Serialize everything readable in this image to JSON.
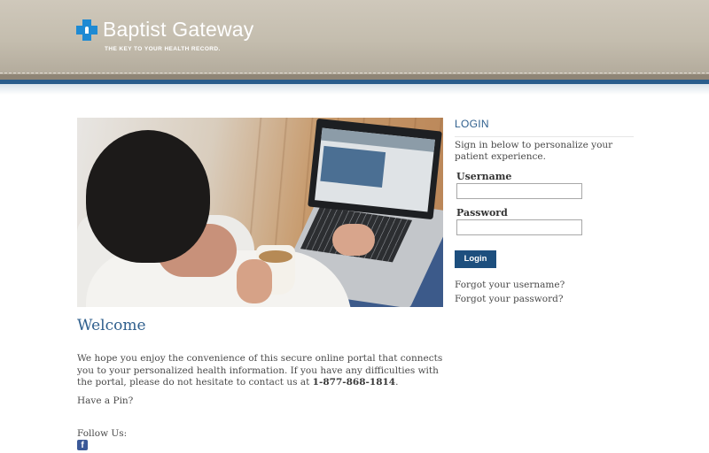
{
  "header": {
    "brand_name": "Baptist Gateway",
    "tagline": "THE KEY TO YOUR HEALTH RECORD.",
    "logo_icon": "medical-cross-keyhole-icon"
  },
  "main": {
    "welcome_heading": "Welcome",
    "intro_text": "We hope you enjoy the convenience of this secure online portal that connects you to your personalized health information. If you have any difficulties with the portal, please do not hesitate to contact us at ",
    "phone": "1-877-868-1814",
    "intro_end": ".",
    "pin_text": "Have a Pin?",
    "follow_label": "Follow Us:",
    "social_icon": "facebook-icon",
    "social_letter": "f"
  },
  "login": {
    "title": "LOGIN",
    "description": "Sign in below to personalize your patient experience.",
    "username_label": "Username",
    "username_value": "",
    "password_label": "Password",
    "password_value": "",
    "button_label": "Login",
    "forgot_username": "Forgot your username?",
    "forgot_password": "Forgot your password?"
  },
  "colors": {
    "header_tan": "#c4bdae",
    "brand_blue": "#2f5f8d",
    "button_blue": "#1d4f7e",
    "logo_blue": "#1e8ad3"
  }
}
